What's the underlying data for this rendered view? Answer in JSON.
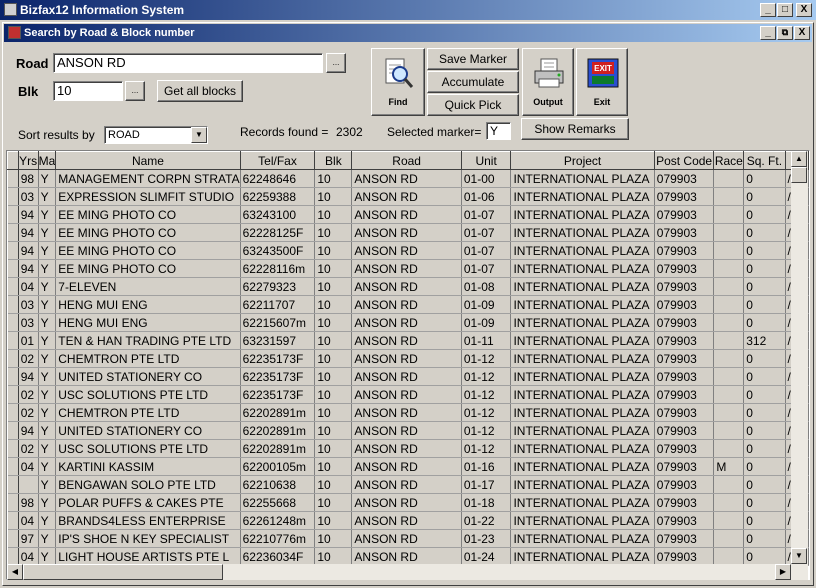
{
  "app": {
    "title": "Bizfax12 Information System"
  },
  "window": {
    "title": "Search by Road & Block number"
  },
  "search": {
    "road_label": "Road",
    "road_value": "ANSON RD",
    "blk_label": "Blk",
    "blk_value": "10",
    "get_all_blocks": "Get all blocks",
    "sort_label": "Sort results by",
    "sort_value": "ROAD",
    "records_label": "Records found =",
    "records_value": "2302",
    "selected_marker_label": "Selected marker=",
    "selected_marker_value": "Y"
  },
  "toolbar": {
    "find": "Find",
    "save_marker": "Save Marker",
    "accumulate": "Accumulate",
    "quick_pick": "Quick Pick",
    "output": "Output",
    "exit": "Exit",
    "exit_icon_text": "EXIT",
    "show_remarks": "Show Remarks"
  },
  "table": {
    "columns": [
      "Yrs",
      "Ma",
      "Name",
      "Tel/Fax",
      "Blk",
      "Road",
      "Unit",
      "Project",
      "Post Code",
      "Race",
      "Sq. Ft.",
      ""
    ],
    "rows": [
      [
        "98",
        "Y",
        "MANAGEMENT CORPN STRATA",
        "62248646",
        "10",
        "ANSON RD",
        "01-00",
        "INTERNATIONAL PLAZA",
        "079903",
        "",
        "0",
        "/"
      ],
      [
        "03",
        "Y",
        "EXPRESSION SLIMFIT STUDIO",
        "62259388",
        "10",
        "ANSON RD",
        "01-06",
        "INTERNATIONAL PLAZA",
        "079903",
        "",
        "0",
        "/"
      ],
      [
        "94",
        "Y",
        "EE MING PHOTO CO",
        "63243100",
        "10",
        "ANSON RD",
        "01-07",
        "INTERNATIONAL PLAZA",
        "079903",
        "",
        "0",
        "/"
      ],
      [
        "94",
        "Y",
        "EE MING PHOTO CO",
        "62228125F",
        "10",
        "ANSON RD",
        "01-07",
        "INTERNATIONAL PLAZA",
        "079903",
        "",
        "0",
        "/"
      ],
      [
        "94",
        "Y",
        "EE MING PHOTO CO",
        "63243500F",
        "10",
        "ANSON RD",
        "01-07",
        "INTERNATIONAL PLAZA",
        "079903",
        "",
        "0",
        "/"
      ],
      [
        "94",
        "Y",
        "EE MING PHOTO CO",
        "62228116m",
        "10",
        "ANSON RD",
        "01-07",
        "INTERNATIONAL PLAZA",
        "079903",
        "",
        "0",
        "/"
      ],
      [
        "04",
        "Y",
        "7-ELEVEN",
        "62279323",
        "10",
        "ANSON RD",
        "01-08",
        "INTERNATIONAL PLAZA",
        "079903",
        "",
        "0",
        "/"
      ],
      [
        "03",
        "Y",
        "HENG MUI ENG",
        "62211707",
        "10",
        "ANSON RD",
        "01-09",
        "INTERNATIONAL PLAZA",
        "079903",
        "",
        "0",
        "/"
      ],
      [
        "03",
        "Y",
        "HENG MUI ENG",
        "62215607m",
        "10",
        "ANSON RD",
        "01-09",
        "INTERNATIONAL PLAZA",
        "079903",
        "",
        "0",
        "/"
      ],
      [
        "01",
        "Y",
        "TEN & HAN TRADING PTE LTD",
        "63231597",
        "10",
        "ANSON RD",
        "01-11",
        "INTERNATIONAL PLAZA",
        "079903",
        "",
        "312",
        "/"
      ],
      [
        "02",
        "Y",
        "CHEMTRON PTE LTD",
        "62235173F",
        "10",
        "ANSON RD",
        "01-12",
        "INTERNATIONAL PLAZA",
        "079903",
        "",
        "0",
        "/"
      ],
      [
        "94",
        "Y",
        "UNITED STATIONERY CO",
        "62235173F",
        "10",
        "ANSON RD",
        "01-12",
        "INTERNATIONAL PLAZA",
        "079903",
        "",
        "0",
        "/"
      ],
      [
        "02",
        "Y",
        "USC SOLUTIONS PTE LTD",
        "62235173F",
        "10",
        "ANSON RD",
        "01-12",
        "INTERNATIONAL PLAZA",
        "079903",
        "",
        "0",
        "/"
      ],
      [
        "02",
        "Y",
        "CHEMTRON PTE LTD",
        "62202891m",
        "10",
        "ANSON RD",
        "01-12",
        "INTERNATIONAL PLAZA",
        "079903",
        "",
        "0",
        "/"
      ],
      [
        "94",
        "Y",
        "UNITED STATIONERY CO",
        "62202891m",
        "10",
        "ANSON RD",
        "01-12",
        "INTERNATIONAL PLAZA",
        "079903",
        "",
        "0",
        "/"
      ],
      [
        "02",
        "Y",
        "USC SOLUTIONS PTE LTD",
        "62202891m",
        "10",
        "ANSON RD",
        "01-12",
        "INTERNATIONAL PLAZA",
        "079903",
        "",
        "0",
        "/"
      ],
      [
        "04",
        "Y",
        "KARTINI KASSIM",
        "62200105m",
        "10",
        "ANSON RD",
        "01-16",
        "INTERNATIONAL PLAZA",
        "079903",
        "M",
        "0",
        "/"
      ],
      [
        "",
        "Y",
        "BENGAWAN SOLO PTE LTD",
        "62210638",
        "10",
        "ANSON RD",
        "01-17",
        "INTERNATIONAL PLAZA",
        "079903",
        "",
        "0",
        "/"
      ],
      [
        "98",
        "Y",
        "POLAR PUFFS & CAKES PTE",
        "62255668",
        "10",
        "ANSON RD",
        "01-18",
        "INTERNATIONAL PLAZA",
        "079903",
        "",
        "0",
        "/"
      ],
      [
        "04",
        "Y",
        "BRANDS4LESS ENTERPRISE",
        "62261248m",
        "10",
        "ANSON RD",
        "01-22",
        "INTERNATIONAL PLAZA",
        "079903",
        "",
        "0",
        "/"
      ],
      [
        "97",
        "Y",
        "IP'S SHOE N KEY SPECIALIST",
        "62210776m",
        "10",
        "ANSON RD",
        "01-23",
        "INTERNATIONAL PLAZA",
        "079903",
        "",
        "0",
        "/"
      ],
      [
        "04",
        "Y",
        "LIGHT HOUSE ARTISTS PTE L",
        "62236034F",
        "10",
        "ANSON RD",
        "01-24",
        "INTERNATIONAL PLAZA",
        "079903",
        "",
        "0",
        "/"
      ]
    ]
  },
  "icons": {
    "window_min": "_",
    "window_max": "□",
    "window_close": "X",
    "inner_max": "⧉",
    "browse": "...",
    "dropdown": "▼",
    "scroll_up": "▲",
    "scroll_down": "▼",
    "scroll_left": "◀",
    "scroll_right": "▶"
  }
}
